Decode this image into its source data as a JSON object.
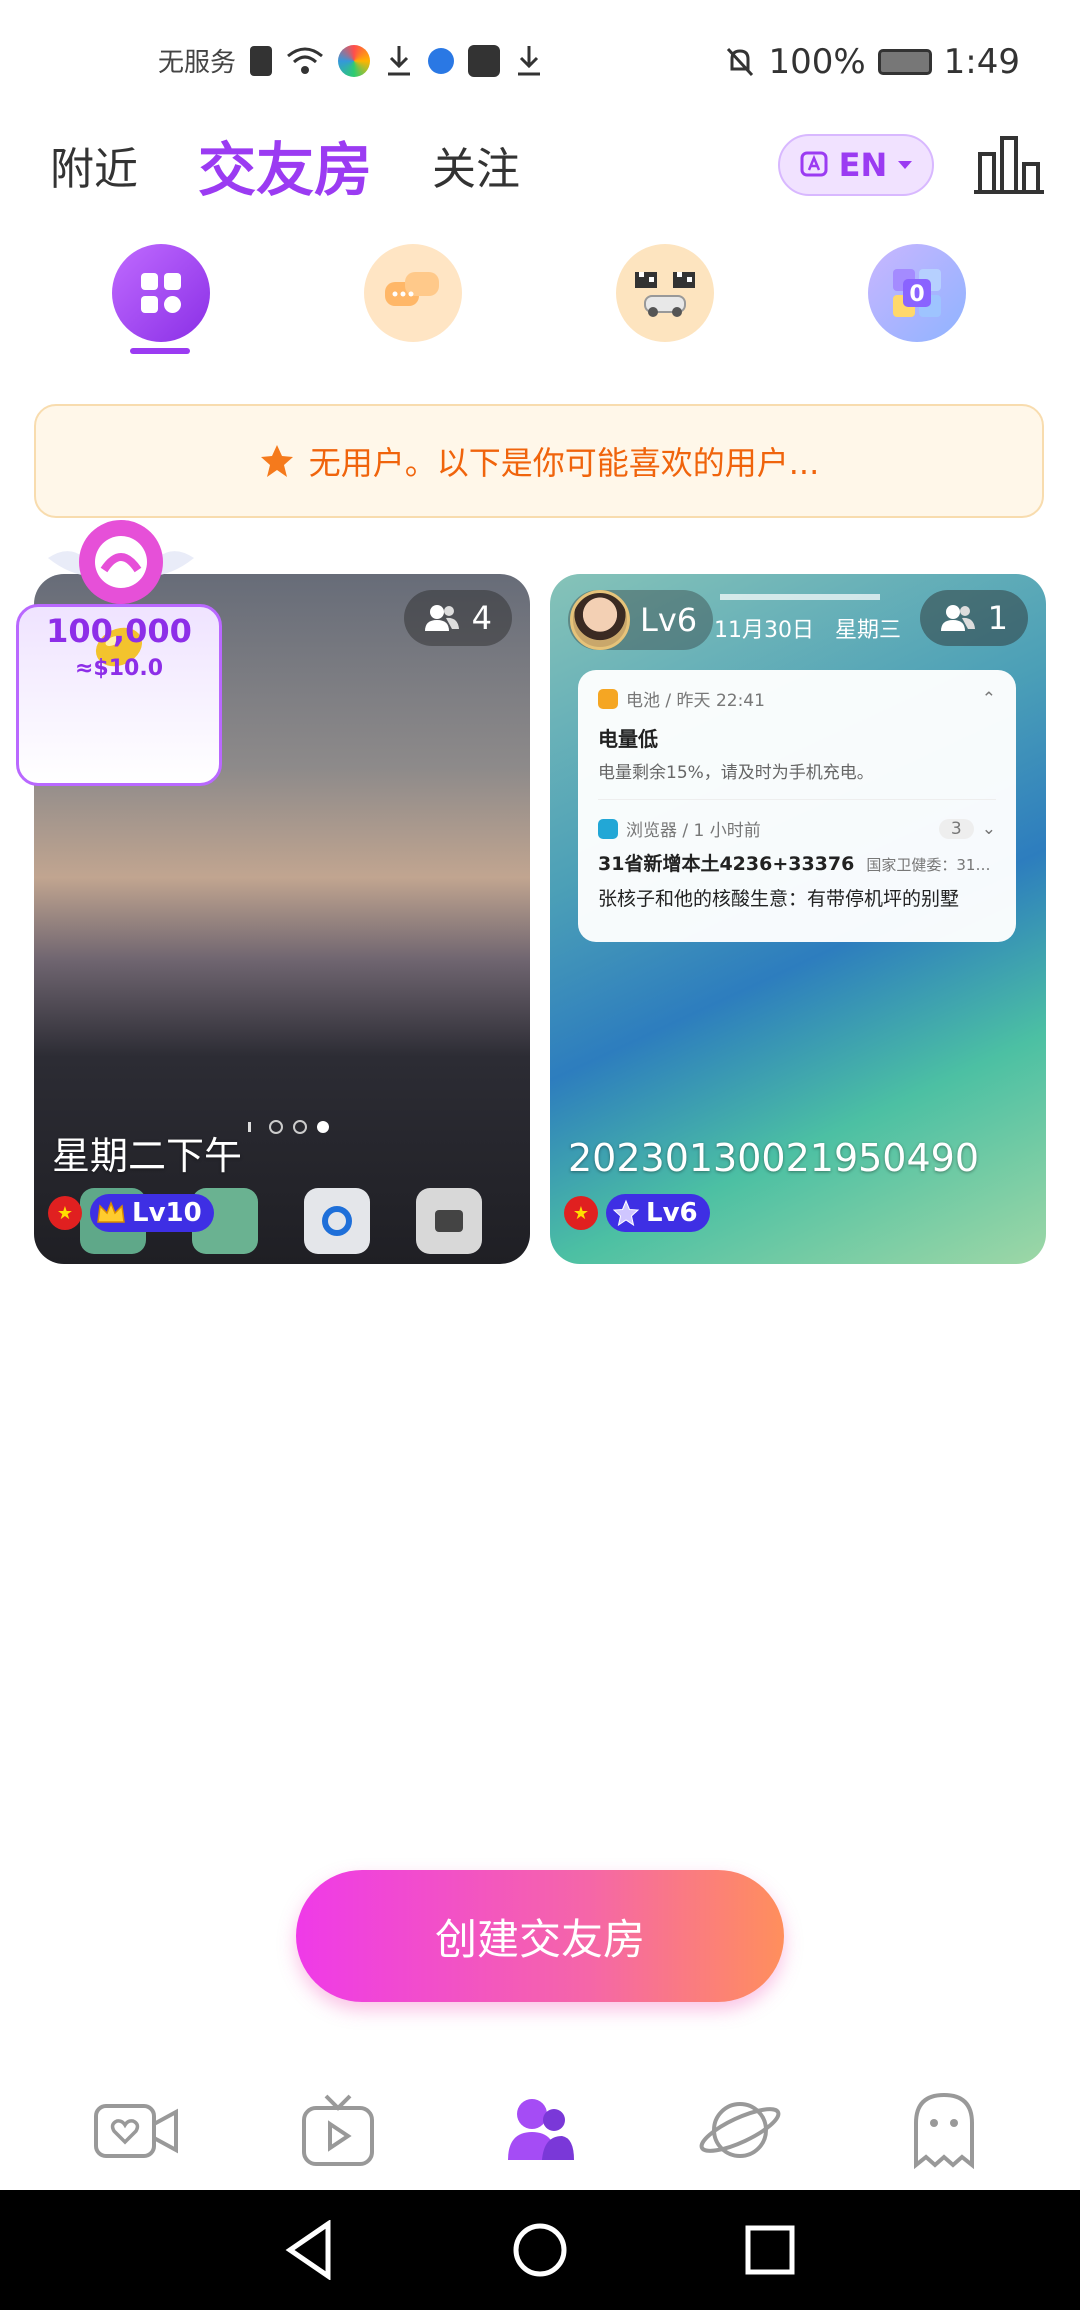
{
  "status_bar": {
    "carrier": "无服务",
    "battery": "100%",
    "time": "1:49"
  },
  "tabs": [
    {
      "label": "附近"
    },
    {
      "label": "交友房"
    },
    {
      "label": "关注"
    }
  ],
  "language_button": {
    "label": "EN"
  },
  "notice": {
    "text": "无用户。以下是你可能喜欢的用户..."
  },
  "reward": {
    "amount": "100,000",
    "usd": "≈$10.0"
  },
  "rooms": [
    {
      "name": "星期二下午",
      "member_count": "4",
      "level": "Lv10",
      "level_icon": "crown-icon"
    },
    {
      "name": "20230130021950490",
      "member_count": "1",
      "owner_level": "Lv6",
      "level": "Lv6",
      "level_icon": "star-icon",
      "screen": {
        "clock_date": "11月30日",
        "clock_weekday": "星期三",
        "n1_app": "电池 / 昨天 22:41",
        "n1_title": "电量低",
        "n1_body": "电量剩余15%，请及时为手机充电。",
        "n2_app": "浏览器 / 1 小时前",
        "n2_count": "3",
        "n2_line1": "31省新增本土4236+33376",
        "n2_line1_src": "国家卫健委：31…",
        "n2_line2": "张核子和他的核酸生意：有带停机坪的别墅"
      }
    }
  ],
  "create_button": {
    "label": "创建交友房"
  },
  "colors": {
    "accent": "#9b3bf2",
    "notice_text": "#f0640c",
    "level_pill": "#3e2fe4"
  }
}
